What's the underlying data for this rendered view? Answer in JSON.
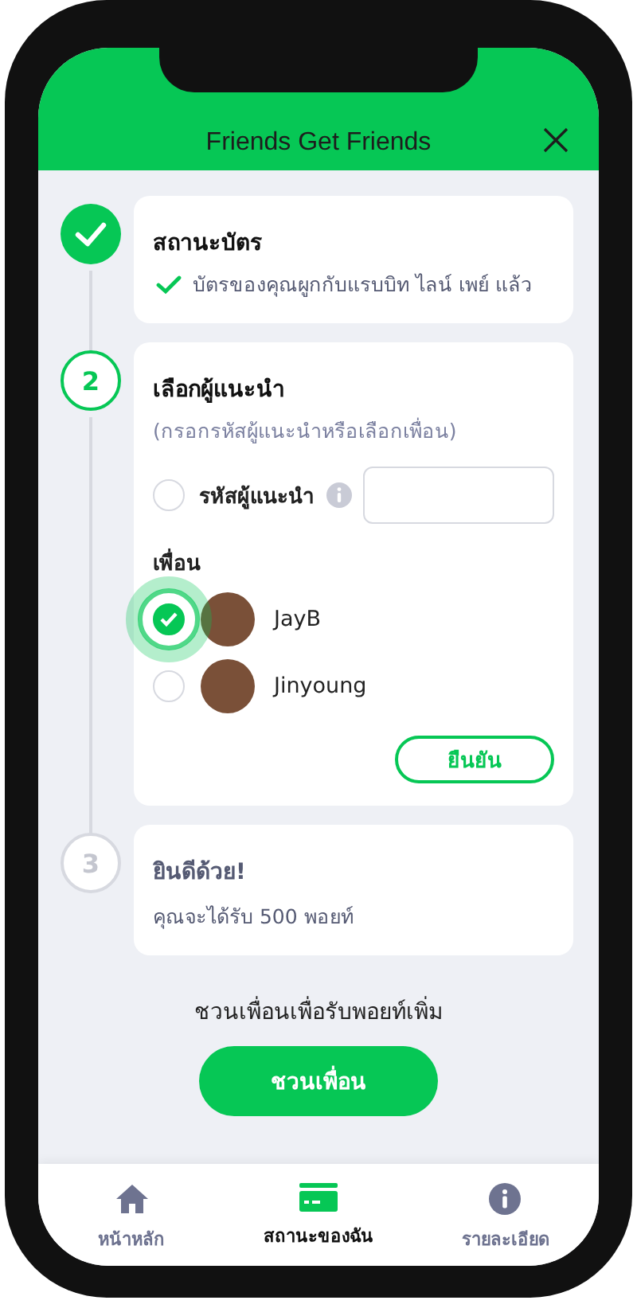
{
  "header": {
    "title": "Friends Get Friends"
  },
  "steps": [
    {
      "kind": "done",
      "title": "สถานะบัตร",
      "note": "บัตรของคุณผูกกับแรบบิท ไลน์ เพย์ แล้ว"
    },
    {
      "kind": "active",
      "number": "2",
      "title": "เลือกผู้แนะนำ",
      "hint": "(กรอกรหัสผู้แนะนำหรือเลือกเพื่อน)",
      "code_option": {
        "label": "รหัสผู้แนะนำ",
        "selected": false
      },
      "friends_label": "เพื่อน",
      "friends": [
        {
          "name": "JayB",
          "selected": true
        },
        {
          "name": "Jinyoung",
          "selected": false
        }
      ],
      "confirm_button": "ยืนยัน"
    },
    {
      "kind": "pending",
      "number": "3",
      "title": "ยินดีด้วย!",
      "text": "คุณจะได้รับ 500 พอยท์"
    }
  ],
  "invite": {
    "text": "ชวนเพื่อนเพื่อรับพอยท์เพิ่ม",
    "button": "ชวนเพื่อน"
  },
  "nav": [
    {
      "kind": "home",
      "label": "หน้าหลัก",
      "selected": false
    },
    {
      "kind": "card",
      "label": "สถานะของฉัน",
      "selected": true
    },
    {
      "kind": "info",
      "label": "รายละเอียด",
      "selected": false
    }
  ]
}
